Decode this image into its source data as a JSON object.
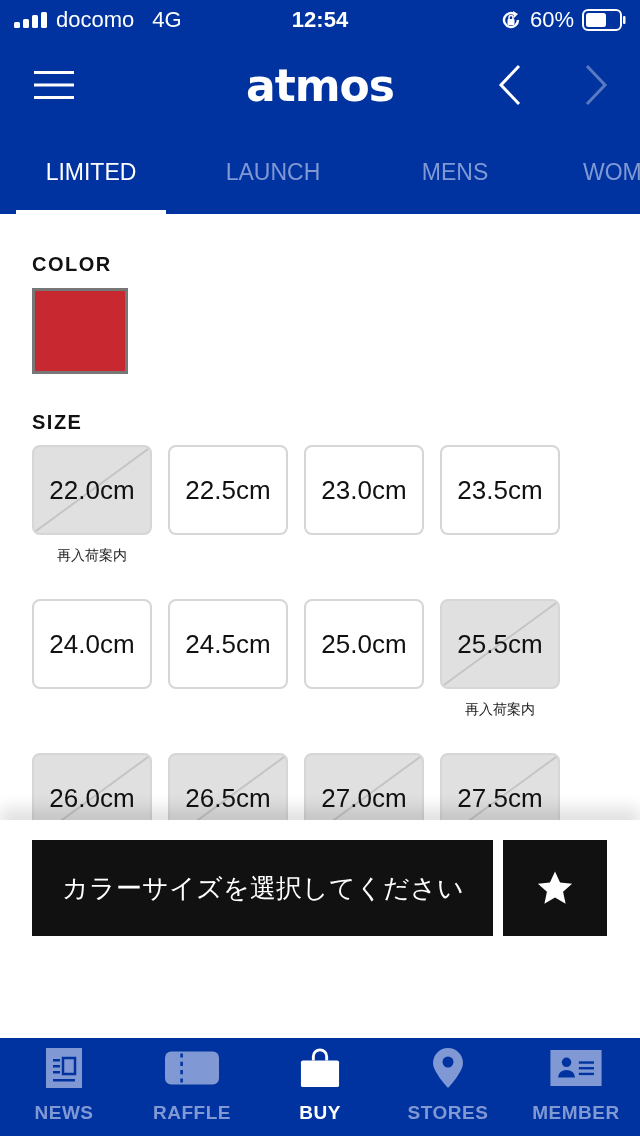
{
  "status_bar": {
    "carrier": "docomo",
    "network": "4G",
    "time": "12:54",
    "battery": "60%"
  },
  "header": {
    "logo": "atmos",
    "back_disabled": false,
    "forward_disabled": true
  },
  "tabs": [
    {
      "label": "LIMITED",
      "selected": true
    },
    {
      "label": "LAUNCH",
      "selected": false
    },
    {
      "label": "MENS",
      "selected": false
    },
    {
      "label": "WOM",
      "selected": false
    }
  ],
  "color_section": {
    "label": "COLOR",
    "swatches": [
      {
        "color": "#c8282f",
        "selected": true
      }
    ]
  },
  "size_section": {
    "label": "SIZE",
    "sizes": [
      {
        "label": "22.0cm",
        "sold_out": true,
        "note": "再入荷案内"
      },
      {
        "label": "22.5cm",
        "sold_out": false
      },
      {
        "label": "23.0cm",
        "sold_out": false
      },
      {
        "label": "23.5cm",
        "sold_out": false
      },
      {
        "label": "24.0cm",
        "sold_out": false
      },
      {
        "label": "24.5cm",
        "sold_out": false
      },
      {
        "label": "25.0cm",
        "sold_out": false
      },
      {
        "label": "25.5cm",
        "sold_out": true,
        "note": "再入荷案内"
      },
      {
        "label": "26.0cm",
        "sold_out": true
      },
      {
        "label": "26.5cm",
        "sold_out": true
      },
      {
        "label": "27.0cm",
        "sold_out": true
      },
      {
        "label": "27.5cm",
        "sold_out": true
      }
    ]
  },
  "action": {
    "button": "カラーサイズを選択してください"
  },
  "bottom_nav": [
    {
      "label": "NEWS",
      "selected": false
    },
    {
      "label": "RAFFLE",
      "selected": false
    },
    {
      "label": "BUY",
      "selected": true
    },
    {
      "label": "STORES",
      "selected": false
    },
    {
      "label": "MEMBER",
      "selected": false
    }
  ]
}
